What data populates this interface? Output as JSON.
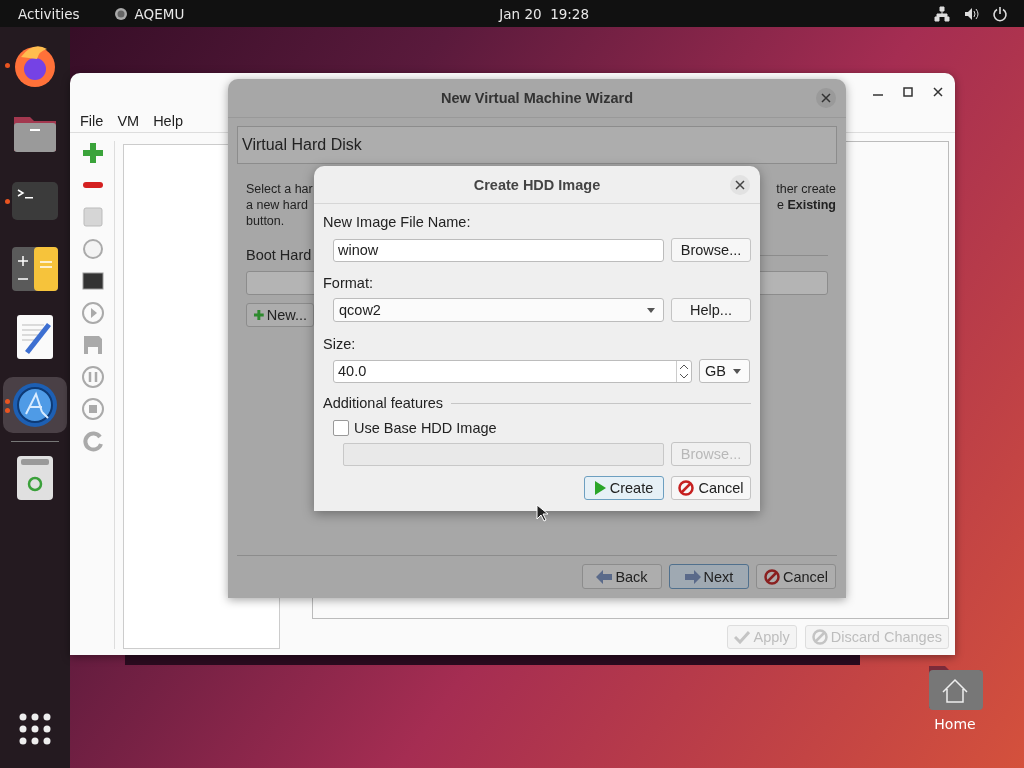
{
  "top_bar": {
    "activities": "Activities",
    "app_name": "AQEMU",
    "clock": "Jan 20  19:28"
  },
  "dock": {
    "items": [
      {
        "kind": "browser",
        "running": true,
        "selected": false
      },
      {
        "kind": "files",
        "running": false,
        "selected": false
      },
      {
        "kind": "terminal",
        "running": true,
        "selected": false
      },
      {
        "kind": "calculator",
        "running": false,
        "selected": false
      },
      {
        "kind": "editor",
        "running": false,
        "selected": false
      },
      {
        "kind": "aqemu",
        "running": true,
        "selected": true
      },
      {
        "kind": "trash",
        "running": false,
        "selected": false
      }
    ]
  },
  "main_window": {
    "menu": [
      "File",
      "VM",
      "Help"
    ],
    "buttons": [
      {
        "kind": "apply",
        "label": "Apply",
        "disabled": true
      },
      {
        "kind": "discard",
        "label": "Discard Changes",
        "disabled": true
      }
    ]
  },
  "wizard": {
    "title": "New Virtual Machine Wizard",
    "page_title": "Virtual Hard Disk",
    "intro_left": [
      "Select a har",
      "a new hard",
      "button."
    ],
    "intro_right": [
      "ther create",
      "e **Existing**"
    ],
    "boot_label": "Boot Hard",
    "new_button": "New...",
    "buttons": [
      {
        "kind": "back",
        "label": "Back",
        "focused": false
      },
      {
        "kind": "next",
        "label": "Next",
        "focused": true
      },
      {
        "kind": "cancel",
        "label": "Cancel",
        "focused": false
      }
    ]
  },
  "create_dialog": {
    "title": "Create HDD Image",
    "file_name_label": "New Image File Name:",
    "file_name": "winow",
    "browse": "Browse...",
    "format_label": "Format:",
    "format": "qcow2",
    "help": "Help...",
    "size_label": "Size:",
    "size": "40.0",
    "unit": "GB",
    "features_label": "Additional features",
    "use_base": {
      "label": "Use Base HDD Image",
      "checked": false
    },
    "base_browse": {
      "label": "Browse...",
      "disabled": true
    },
    "buttons": [
      {
        "kind": "create",
        "label": "Create",
        "focused": true
      },
      {
        "kind": "cancel",
        "label": "Cancel",
        "focused": false
      }
    ]
  },
  "desktop_icons": [
    {
      "label": "Home"
    }
  ]
}
